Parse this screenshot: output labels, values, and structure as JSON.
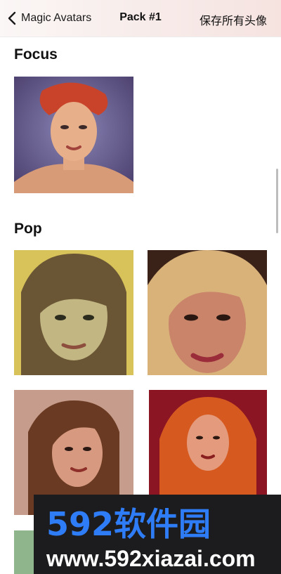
{
  "nav": {
    "back_label": "Magic Avatars",
    "title": "Pack #1",
    "save_all": "保存所有头像"
  },
  "sections": [
    {
      "title": "Focus",
      "images": [
        "Focus avatar 1"
      ]
    },
    {
      "title": "Pop",
      "images": [
        "Pop avatar 1",
        "Pop avatar 2",
        "Pop avatar 3",
        "Pop avatar 4"
      ]
    }
  ],
  "watermark": {
    "brand": "592软件园",
    "url": "www.592xiazai.com"
  },
  "colors": {
    "nav_gradient_start": "#fbf7f6",
    "nav_gradient_end": "#f6e3e0",
    "watermark_bg": "#1c1c1e",
    "watermark_blue": "#2f7df6"
  },
  "icons": [
    "chevron-left-icon"
  ]
}
